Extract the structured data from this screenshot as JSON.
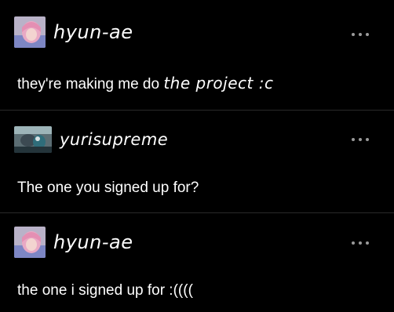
{
  "posts": [
    {
      "username": "hyun-ae",
      "avatar_icon": "pink-hair-avatar-icon",
      "message_plain": "they're making me do ",
      "message_handwritten": "the project :c",
      "menu_icon": "more-horizontal-icon"
    },
    {
      "username": "yurisupreme",
      "avatar_icon": "anime-scene-avatar-icon",
      "message_plain": "The one you signed up for?",
      "message_handwritten": "",
      "menu_icon": "more-horizontal-icon"
    },
    {
      "username": "hyun-ae",
      "avatar_icon": "pink-hair-avatar-icon",
      "message_plain": "the one i signed up for :((((",
      "message_handwritten": "",
      "menu_icon": "more-horizontal-icon"
    }
  ],
  "colors": {
    "background": "#000000",
    "text": "#ffffff",
    "menu_dots": "#9a9a9a",
    "divider": "#2a2a2a"
  }
}
